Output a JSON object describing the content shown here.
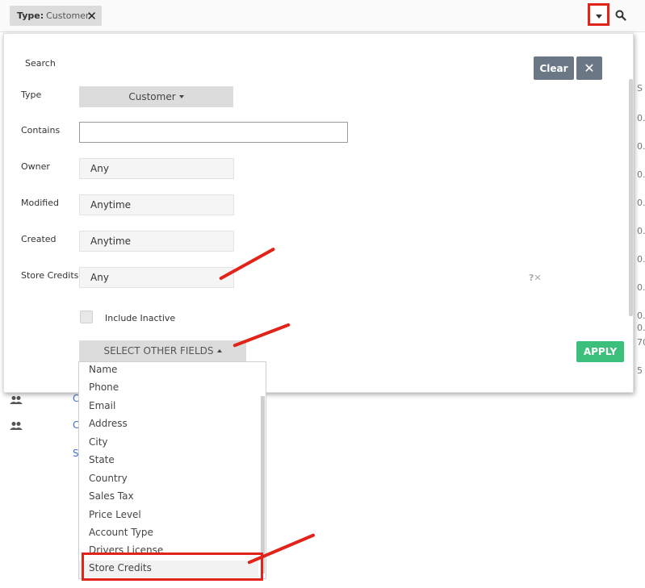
{
  "filter_chip": {
    "label": "Type:",
    "value": "Customer",
    "remove": "✕"
  },
  "panel": {
    "title": "Search",
    "clear_label": "Clear",
    "close_label": "✕",
    "fields": {
      "type_label": "Type",
      "type_value": "Customer",
      "contains_label": "Contains",
      "contains_value": "",
      "owner_label": "Owner",
      "owner_value": "Any",
      "modified_label": "Modified",
      "modified_value": "Anytime",
      "created_label": "Created",
      "created_value": "Anytime",
      "store_credits_label": "Store Credits",
      "store_credits_value": "Any"
    },
    "help_icons": "?✕",
    "include_inactive_label": "Include Inactive",
    "select_other_label": "SELECT OTHER FIELDS",
    "apply_label": "APPLY"
  },
  "dropdown": {
    "items": [
      "Name",
      "Phone",
      "Email",
      "Address",
      "City",
      "State",
      "Country",
      "Sales Tax",
      "Price Level",
      "Account Type",
      "Drivers License",
      "Store Credits"
    ]
  },
  "background": {
    "column_header": "S",
    "column_values": [
      "0.",
      "0.",
      "0.",
      "0.",
      "0.",
      "0.",
      "0.",
      "0.",
      "0.",
      "70",
      "5"
    ],
    "links": [
      "C",
      "C",
      "S"
    ]
  },
  "colors": {
    "annotation_red": "#e2231a",
    "clear_button": "#6b7785",
    "apply_button": "#3cbf7b",
    "chip_bg": "#dcdcdc"
  },
  "icons": {
    "caret": "chevron-down-icon",
    "search": "search-icon",
    "users": "users-icon"
  }
}
